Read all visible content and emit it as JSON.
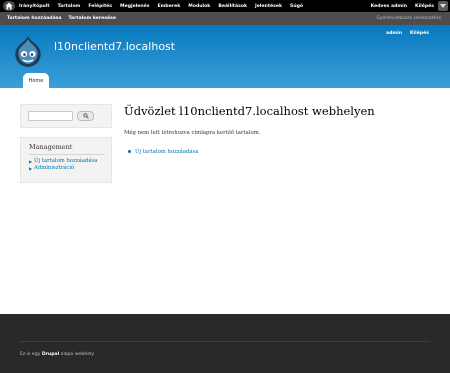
{
  "toolbar": {
    "home_icon": "home-icon",
    "menu": [
      "Irányítópult",
      "Tartalom",
      "Felépítés",
      "Megjelenés",
      "Emberek",
      "Modulok",
      "Beállítások",
      "Jelentések",
      "Súgó"
    ],
    "user": {
      "greeting": "Kedves admin",
      "logout": "Kilépés"
    },
    "toggle_icon": "chevron-down-icon"
  },
  "shortcuts": {
    "links": [
      "Tartalom hozzáadása",
      "Tartalom keresése"
    ],
    "edit": "Gyorshivatkozás szerkesztése"
  },
  "header": {
    "site_name": "l10nclientd7.localhost",
    "secondary": [
      "admin",
      "Kilépés"
    ],
    "tab": "Home"
  },
  "search": {
    "placeholder": "",
    "button_icon": "search-icon"
  },
  "management": {
    "title": "Management",
    "items": [
      "Új tartalom hozzáadása",
      "Adminisztráció"
    ]
  },
  "content": {
    "title": "Üdvözlet l10nclientd7.localhost webhelyen",
    "message": "Még nem lett létrehozva címlapra kerülő tartalom.",
    "link": "Új tartalom hozzáadása"
  },
  "footer": {
    "prefix": "Ez is egy",
    "brand": "Drupal",
    "suffix": "alapú webhely"
  },
  "colors": {
    "header_top": "#0779bf",
    "header_bottom": "#3b9fd8",
    "link": "#0071b3",
    "footer": "#292929",
    "toolbar": "#000000"
  }
}
